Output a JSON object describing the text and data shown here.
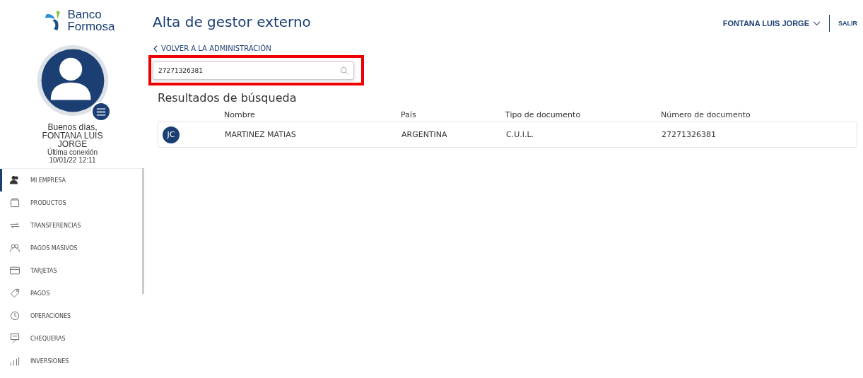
{
  "logo": {
    "line1": "Banco",
    "line2": "Formosa"
  },
  "user": {
    "greeting": "Buenos días,",
    "name": "FONTANA LUIS JORGE",
    "last_login_label": "Última conexión",
    "last_login": "10/01/22 12:11"
  },
  "sidebar": {
    "items": [
      {
        "label": "MI EMPRESA",
        "selected": true
      },
      {
        "label": "PRODUCTOS",
        "selected": false
      },
      {
        "label": "TRANSFERENCIAS",
        "selected": false
      },
      {
        "label": "PAGOS MASIVOS",
        "selected": false
      },
      {
        "label": "TARJETAS",
        "selected": false
      },
      {
        "label": "PAGOS",
        "selected": false
      },
      {
        "label": "OPERACIONES",
        "selected": false
      },
      {
        "label": "CHEQUERAS",
        "selected": false
      },
      {
        "label": "INVERSIONES",
        "selected": false
      }
    ]
  },
  "header": {
    "title": "Alta de gestor externo",
    "user_menu": "FONTANA LUIS JORGE",
    "logout": "SALIR"
  },
  "back_link": "VOLVER A LA ADMINISTRACIÓN",
  "search": {
    "value": "27271326381"
  },
  "results": {
    "title": "Resultados de búsqueda",
    "columns": [
      "Nombre",
      "País",
      "Tipo de documento",
      "Número de documento"
    ],
    "rows": [
      {
        "initials": "JC",
        "cells": [
          "MARTINEZ MATIAS",
          "ARGENTINA",
          "C.U.I.L.",
          "27271326381"
        ]
      }
    ]
  }
}
